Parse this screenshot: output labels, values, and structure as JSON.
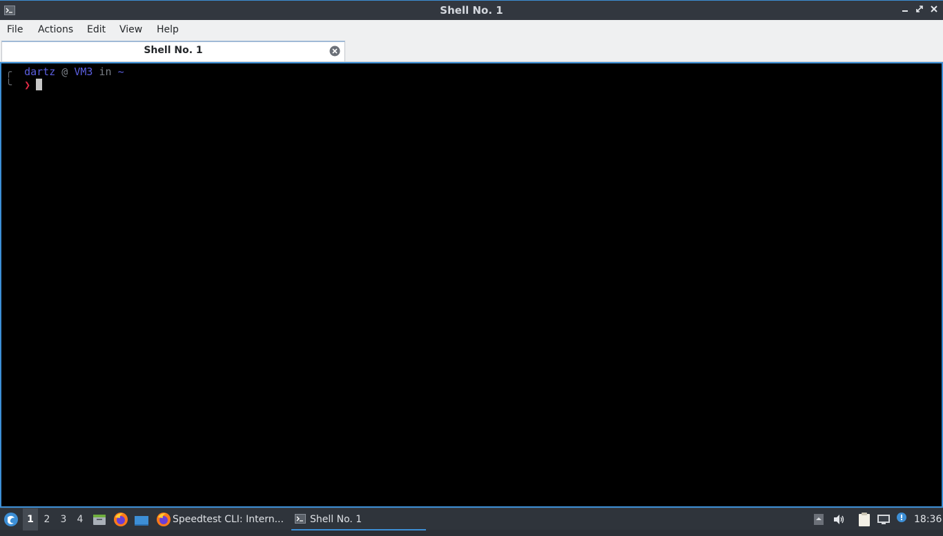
{
  "window": {
    "title": "Shell No. 1",
    "controls": [
      "minimize",
      "maximize",
      "close"
    ]
  },
  "menubar": {
    "items": [
      "File",
      "Actions",
      "Edit",
      "View",
      "Help"
    ]
  },
  "tabs": [
    {
      "label": "Shell No. 1",
      "active": true
    }
  ],
  "terminal": {
    "user": "dartz",
    "at": "@",
    "host": "VM3",
    "in_word": "in",
    "cwd": "~",
    "prompt_symbol": "❯",
    "bracket_top": "╭",
    "bracket_bottom": "╰"
  },
  "taskbar": {
    "workspaces": [
      "1",
      "2",
      "3",
      "4"
    ],
    "active_workspace": "1",
    "tasks": [
      {
        "label": "Speedtest CLI: Intern...",
        "icon": "firefox-icon",
        "active": false
      },
      {
        "label": "Shell No. 1",
        "icon": "terminal-icon",
        "active": true
      }
    ],
    "clock": "18:36"
  },
  "colors": {
    "accent": "#3d8fd6",
    "prompt_user": "#5b5fe0",
    "prompt_arrow": "#e02a46"
  }
}
